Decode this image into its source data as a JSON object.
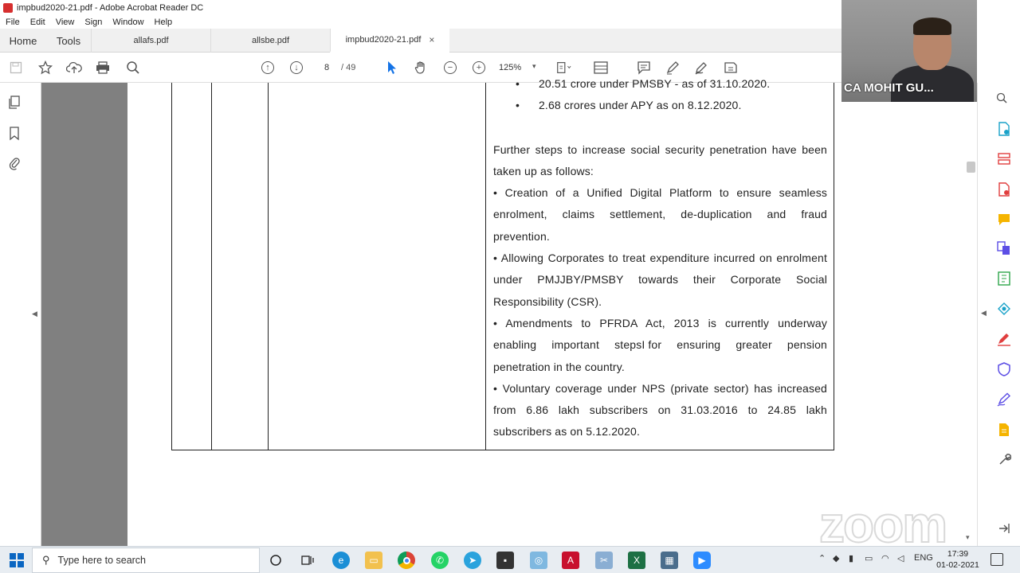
{
  "window": {
    "title": "impbud2020-21.pdf - Adobe Acrobat Reader DC"
  },
  "menu": [
    "File",
    "Edit",
    "View",
    "Sign",
    "Window",
    "Help"
  ],
  "tabs": {
    "home": "Home",
    "tools": "Tools",
    "files": [
      "allafs.pdf",
      "allsbe.pdf",
      "impbud2020-21.pdf"
    ],
    "close": "×"
  },
  "toolbar": {
    "page_current": "8",
    "page_total": "/ 49",
    "zoom": "125%"
  },
  "document": {
    "bullets": [
      "20.51 crore under PMSBY - as of 31.10.2020.",
      "2.68 crores under APY as on 8.12.2020."
    ],
    "para_intro": "Further steps to increase social security penetration have been taken up as follows:",
    "para_1": "• Creation of a Unified Digital Platform to ensure seamless enrolment, claims settlement, de-duplication and fraud prevention.",
    "para_2": "• Allowing Corporates to treat expenditure incurred on enrolment under PMJJBY/PMSBY towards their Corporate Social Responsibility (CSR).",
    "para_3a": "• Amendments to PFRDA Act, 2013 is currently underway enabling important steps",
    "para_3b": "for ensuring greater pension penetration in the country.",
    "para_4": "• Voluntary coverage under NPS (private sector) has increased from 6.86 lakh subscribers on 31.03.2016 to 24.85 lakh subscribers as on 5.12.2020."
  },
  "webcam": {
    "name": "CA MOHIT GU..."
  },
  "watermark": "zoom",
  "taskbar": {
    "search_placeholder": "Type here to search",
    "lang": "ENG",
    "time": "17:39",
    "date": "01-02-2021"
  },
  "colors": {
    "acrobat_red": "#d62f2f",
    "doc_bg": "#808080",
    "taskbar_bg": "#e8edf2"
  }
}
